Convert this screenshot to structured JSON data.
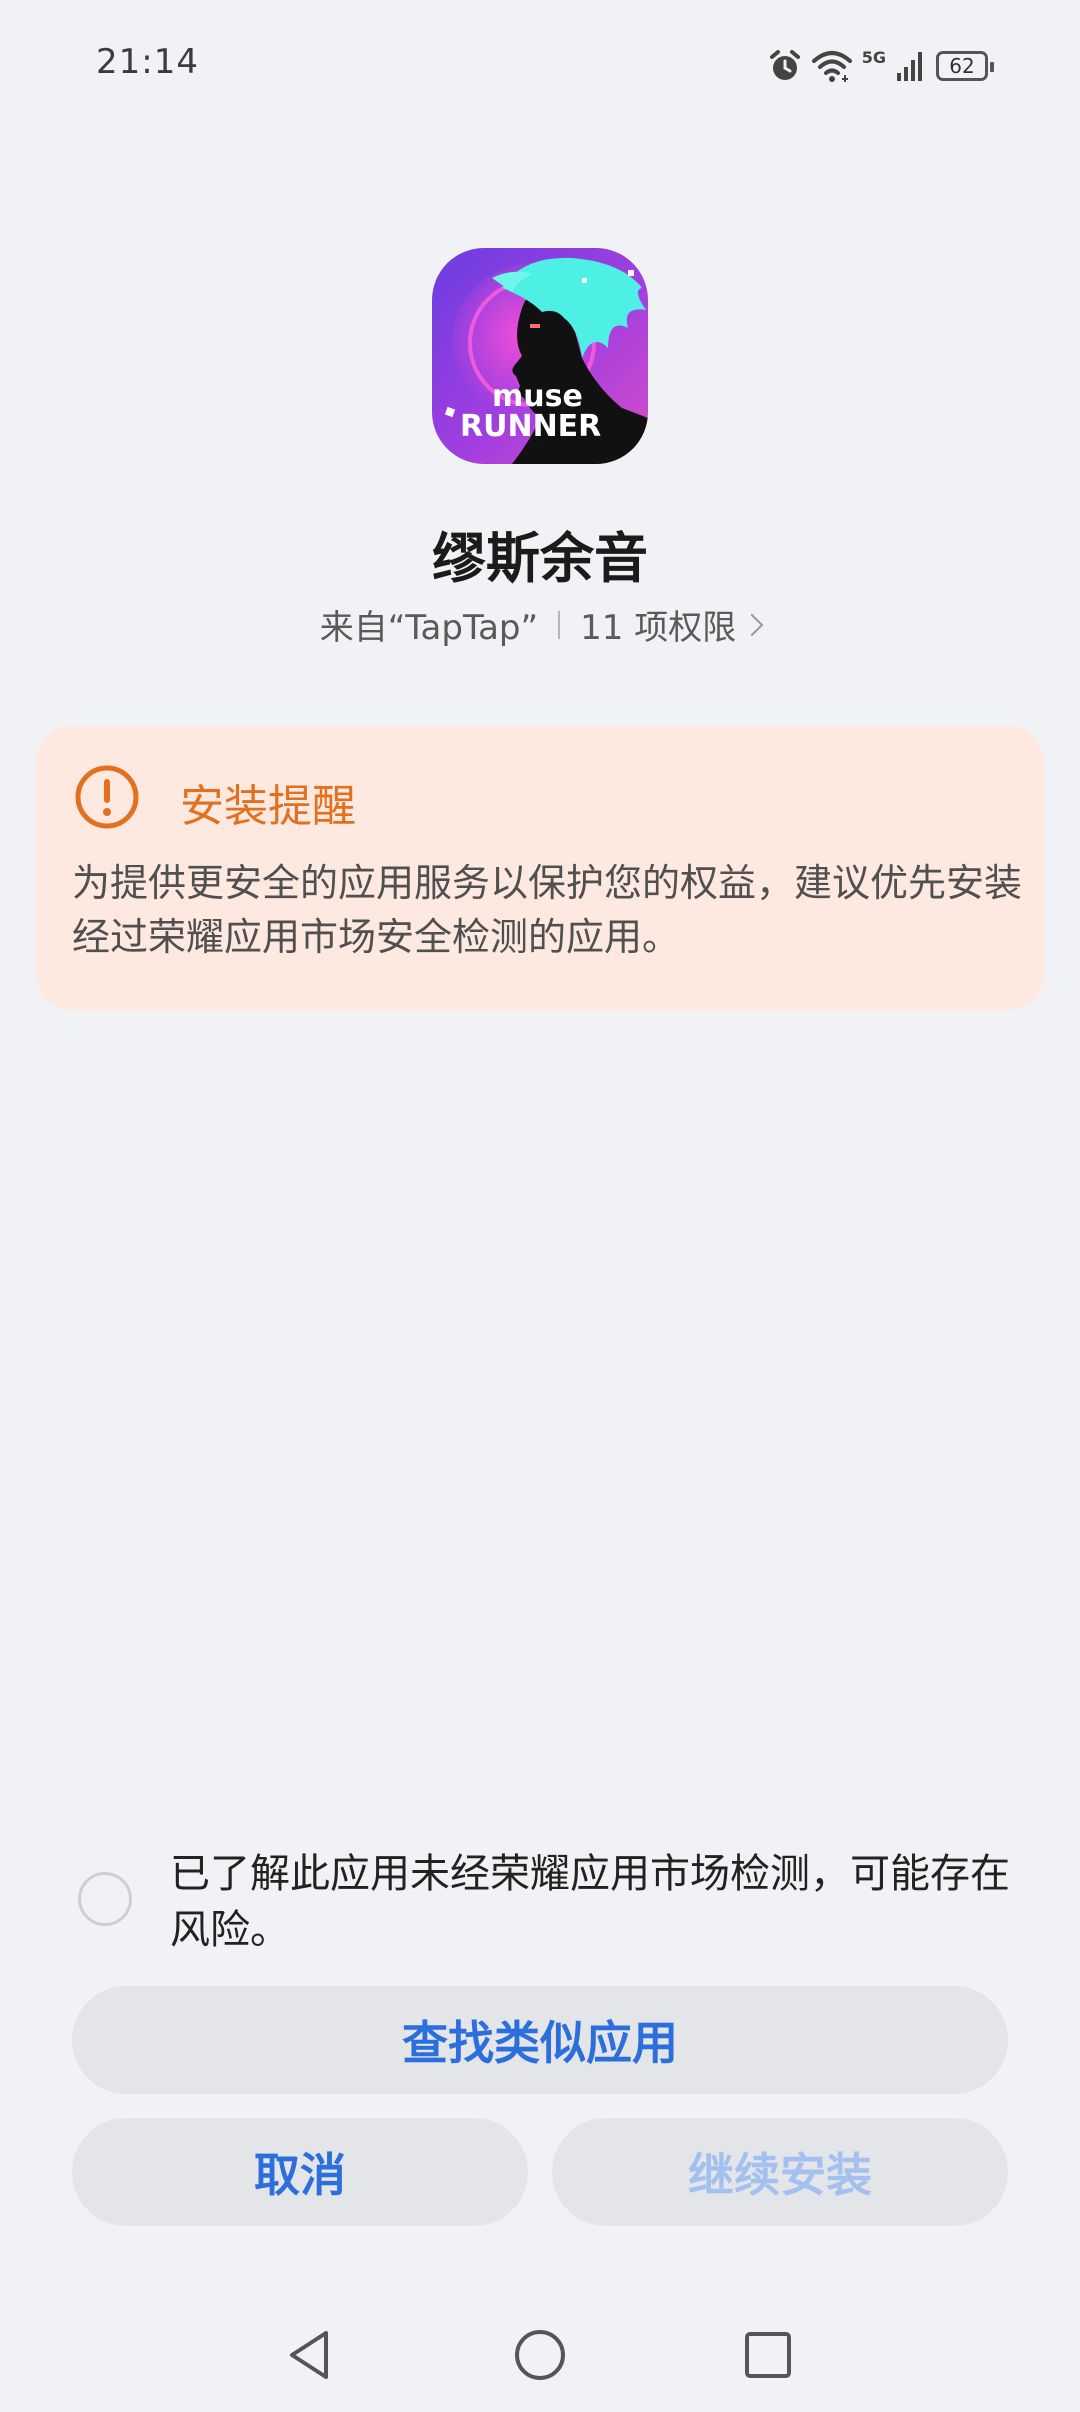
{
  "status_bar": {
    "time": "21:14",
    "network_label": "5G",
    "battery_level": "62",
    "icons": [
      "alarm-icon",
      "wifi-icon",
      "signal-icon",
      "battery-icon"
    ]
  },
  "app": {
    "icon_text_line1": "muse",
    "icon_text_line2": "RUNNER",
    "name": "缪斯余音",
    "source": "来自“TapTap”",
    "permissions": "11 项权限"
  },
  "warning": {
    "title": "安装提醒",
    "text": "为提供更安全的应用服务以保护您的权益，建议优先安装经过荣耀应用市场安全检测的应用。",
    "color": "#e3701f"
  },
  "acknowledge": {
    "text": "已了解此应用未经荣耀应用市场检测，可能存在风险。",
    "checked": false
  },
  "buttons": {
    "find_similar": "查找类似应用",
    "cancel": "取消",
    "continue_install": "继续安装"
  },
  "colors": {
    "accent": "#2c6fdc",
    "disabled": "#a4c0ef",
    "background": "#f1f2f6",
    "warning_bg": "#fde9df"
  },
  "nav": {
    "items": [
      "back-icon",
      "home-icon",
      "recents-icon"
    ]
  }
}
